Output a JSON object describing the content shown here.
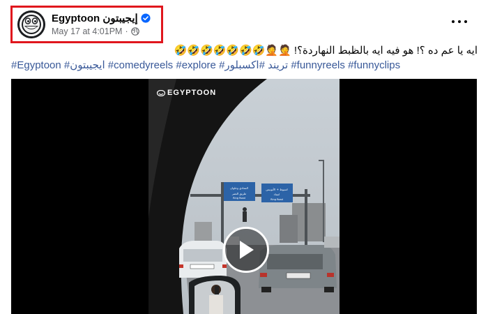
{
  "post": {
    "page_name": "Egyptoon إيجيبتون",
    "date": "May 17 at 4:01PM",
    "separator": "·",
    "caption_ar": "ايه يا عم ده ؟! هو فيه ايه بالظبط النهاردة؟! 🤦🤦🤣🤣🤣🤣🤣🤣🤣",
    "hashtags": [
      "#Egyptoon",
      "#ايجيبتون",
      "#comedyreels",
      "#explore",
      "#تريند",
      "#اكسبلور",
      "#funnyreels",
      "#funnyclips"
    ]
  },
  "video": {
    "watermark": "EGYPTOON",
    "sign_left_ar": "المعادي وحلوان\nطريق النصر",
    "sign_left_en": "Ring Road",
    "sign_right_ar": "اسيوط + الأتوبيس\nاستاد",
    "sign_right_en": "Ring Road"
  },
  "colors": {
    "highlight": "#e0161d",
    "link": "#385898",
    "verified": "#0866ff",
    "meta": "#65676b"
  },
  "icons": [
    "verified-badge-icon",
    "globe-icon",
    "more-options-icon",
    "play-icon"
  ]
}
